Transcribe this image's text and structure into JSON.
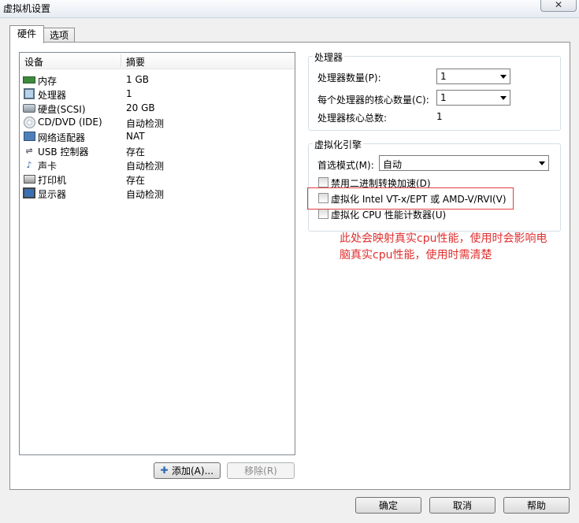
{
  "window": {
    "title": "虚拟机设置",
    "close_glyph": "✕"
  },
  "tabs": [
    {
      "label": "硬件",
      "active": true
    },
    {
      "label": "选项",
      "active": false
    }
  ],
  "device_list": {
    "columns": [
      "设备",
      "摘要"
    ],
    "rows": [
      {
        "name": "内存",
        "summary": "1 GB",
        "icon": "memory-icon"
      },
      {
        "name": "处理器",
        "summary": "1",
        "icon": "processor-icon"
      },
      {
        "name": "硬盘(SCSI)",
        "summary": "20 GB",
        "icon": "hard-disk-icon"
      },
      {
        "name": "CD/DVD (IDE)",
        "summary": "自动检测",
        "icon": "cd-dvd-icon"
      },
      {
        "name": "网络适配器",
        "summary": "NAT",
        "icon": "network-adapter-icon"
      },
      {
        "name": "USB 控制器",
        "summary": "存在",
        "icon": "usb-icon"
      },
      {
        "name": "声卡",
        "summary": "自动检测",
        "icon": "sound-card-icon"
      },
      {
        "name": "打印机",
        "summary": "存在",
        "icon": "printer-icon"
      },
      {
        "name": "显示器",
        "summary": "自动检测",
        "icon": "display-icon"
      }
    ]
  },
  "buttons": {
    "add": "添加(A)...",
    "remove": "移除(R)",
    "ok": "确定",
    "cancel": "取消",
    "help": "帮助"
  },
  "processor": {
    "title": "处理器",
    "count_label": "处理器数量(P):",
    "count_value": "1",
    "cores_label": "每个处理器的核心数量(C):",
    "cores_value": "1",
    "total_label": "处理器核心总数:",
    "total_value": "1"
  },
  "virtualization": {
    "title": "虚拟化引擎",
    "mode_label": "首选模式(M):",
    "mode_value": "自动",
    "options": [
      {
        "label": "禁用二进制转换加速(D)",
        "checked": false
      },
      {
        "label": "虚拟化 Intel VT-x/EPT 或 AMD-V/RVI(V)",
        "checked": false
      },
      {
        "label": "虚拟化 CPU 性能计数器(U)",
        "checked": false
      }
    ]
  },
  "annotation": {
    "line1": "此处会映射真实cpu性能，使用时会影响电",
    "line2": "脑真实cpu性能，使用时需清楚",
    "color": "#e03030"
  }
}
